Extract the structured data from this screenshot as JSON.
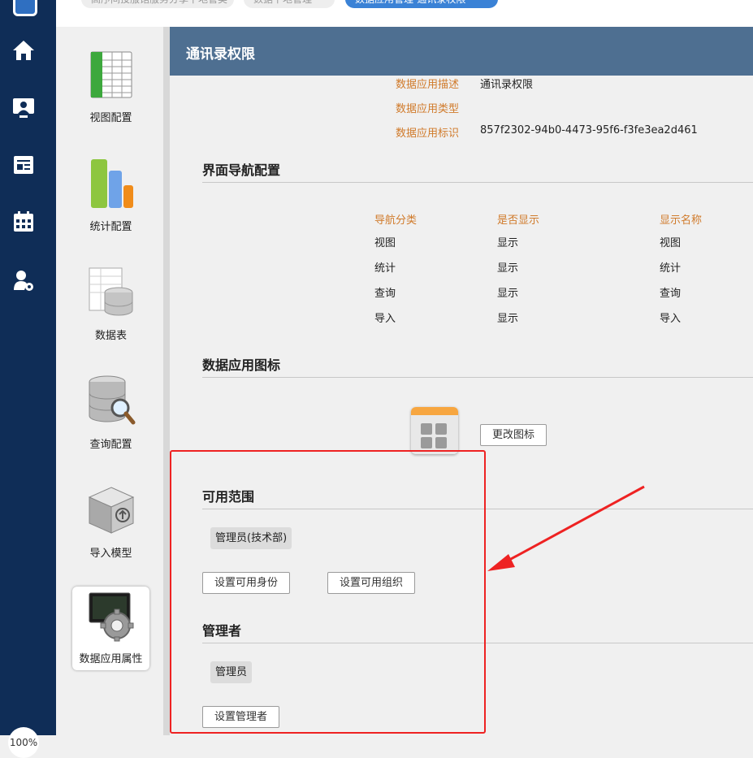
{
  "topbar": {
    "pills": [
      "高序间投服馆服务分享下地管类",
      "数据下地管理",
      "数据应用管理-通讯录权限"
    ]
  },
  "leftnav": {
    "icons": [
      "home-icon",
      "user-monitor-icon",
      "news-icon",
      "calendar-icon",
      "user-settings-icon"
    ],
    "zoom": "100%"
  },
  "tools": [
    {
      "label": "视图配置",
      "icon": "spreadsheet-icon"
    },
    {
      "label": "统计配置",
      "icon": "bar-chart-icon"
    },
    {
      "label": "数据表",
      "icon": "database-table-icon"
    },
    {
      "label": "查询配置",
      "icon": "database-search-icon"
    },
    {
      "label": "导入模型",
      "icon": "import-cube-icon"
    },
    {
      "label": "数据应用属性",
      "icon": "app-settings-icon"
    }
  ],
  "header": {
    "title": "通讯录权限"
  },
  "properties": [
    {
      "label": "数据应用描述",
      "value": "通讯录权限"
    },
    {
      "label": "数据应用类型",
      "value": ""
    },
    {
      "label": "数据应用标识",
      "value": "857f2302-94b0-4473-95f6-f3fe3ea2d461"
    }
  ],
  "nav_config": {
    "title": "界面导航配置",
    "headers": [
      "导航分类",
      "是否显示",
      "显示名称"
    ],
    "rows": [
      [
        "视图",
        "显示",
        "视图"
      ],
      [
        "统计",
        "显示",
        "统计"
      ],
      [
        "查询",
        "显示",
        "查询"
      ],
      [
        "导入",
        "显示",
        "导入"
      ]
    ]
  },
  "app_icon": {
    "title": "数据应用图标",
    "change_button": "更改图标"
  },
  "scope": {
    "title": "可用范围",
    "tags": [
      "管理员(技术部)"
    ],
    "set_identity_button": "设置可用身份",
    "set_org_button": "设置可用组织"
  },
  "admins": {
    "title": "管理者",
    "tags": [
      "管理员"
    ],
    "set_admin_button": "设置管理者"
  },
  "colors": {
    "accent": "#d07a2a",
    "nav_bg": "#0f2d57",
    "header_bg": "#4e6f91",
    "annotation": "#ee2222"
  }
}
